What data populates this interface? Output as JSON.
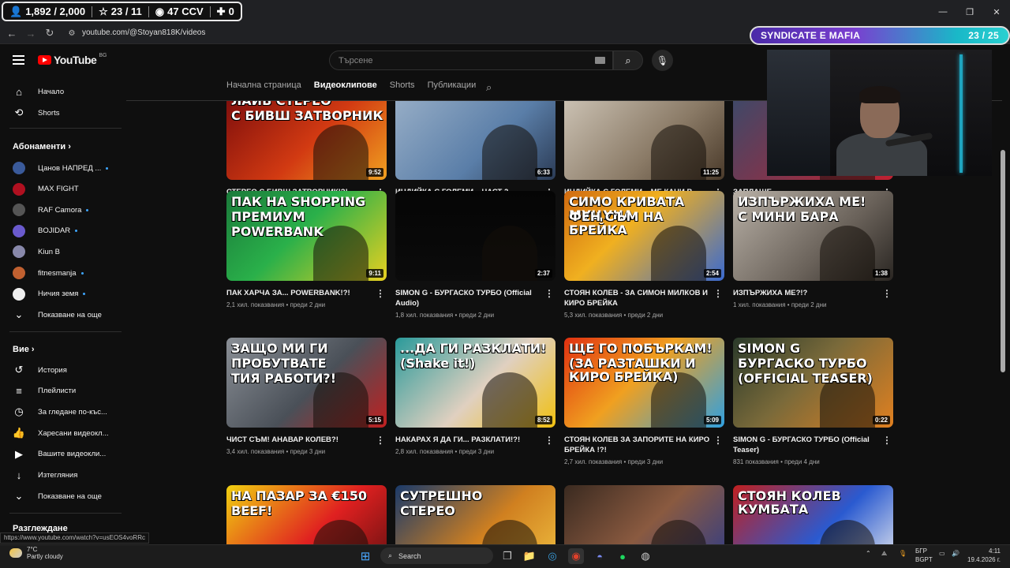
{
  "overlay": {
    "followers": "1,892 / 2,000",
    "stars": "23 / 11",
    "ccv": "47 CCV",
    "plus": "0"
  },
  "browser": {
    "url": "youtube.com/@Stoyan818K/videos",
    "status_url": "https://www.youtube.com/watch?v=usEOS4voRRc"
  },
  "stream_banner": {
    "title": "SYNDICATE E MAFIA",
    "count": "23 / 25"
  },
  "youtube": {
    "logo": "YouTube",
    "country": "BG",
    "search_placeholder": "Търсене"
  },
  "sidebar": {
    "home": "Начало",
    "shorts": "Shorts",
    "subscriptions_heading": "Абонаменти",
    "subscriptions": [
      {
        "name": "Цанов НАПРЕД ...",
        "color": "#3a5a9a",
        "dot": true
      },
      {
        "name": "MAX FIGHT",
        "color": "#b01020",
        "dot": false
      },
      {
        "name": "RAF Camora",
        "color": "#555555",
        "dot": true
      },
      {
        "name": "BOJIDAR",
        "color": "#6a5acd",
        "dot": true
      },
      {
        "name": "Kiun B",
        "color": "#8888aa",
        "dot": false
      },
      {
        "name": "fitnesmanja",
        "color": "#c06030",
        "dot": true
      },
      {
        "name": "Ничия земя",
        "color": "#eeeeee",
        "dot": true
      }
    ],
    "show_more_1": "Показване на още",
    "you_heading": "Вие",
    "you_items": [
      {
        "label": "История",
        "icon": "history-icon",
        "glyph": "↺"
      },
      {
        "label": "Плейлисти",
        "icon": "playlists-icon",
        "glyph": "≡"
      },
      {
        "label": "За гледане по-къс...",
        "icon": "watch-later-icon",
        "glyph": "◷"
      },
      {
        "label": "Харесани видеокл...",
        "icon": "liked-icon",
        "glyph": "👍"
      },
      {
        "label": "Вашите видеокли...",
        "icon": "your-videos-icon",
        "glyph": "▶"
      },
      {
        "label": "Изтегляния",
        "icon": "downloads-icon",
        "glyph": "↓"
      }
    ],
    "show_more_2": "Показване на още",
    "explore_heading": "Разглеждане"
  },
  "tabs": [
    "Начална страница",
    "Видеоклипове",
    "Shorts",
    "Публикации"
  ],
  "videos": [
    {
      "title": "СТЕРЕО С БИВШ ЗАТВОРНИК!?!",
      "meta": "3 хил. показвания • преди 10 часа",
      "duration": "9:52",
      "thumb_text": "ЛАЙВ СТЕРЕО\nС БИВШ ЗАТВОРНИК",
      "bg": "linear-gradient(135deg,#7a0c0c,#d23a12 55%,#f0a020)"
    },
    {
      "title": "ИНДИЙКА С ГОЛЕМИ... ЧАСТ 2",
      "meta": "2,1 хил. показвания • преди 14 часа",
      "duration": "6:33",
      "thumb_text": "",
      "bg": "linear-gradient(135deg,#9ab0c8,#5a7ea8 60%,#2b3b55)"
    },
    {
      "title": "ИНДИЙКА С ГОЛЕМИ... МЕ КАНИ В ДУБАЙ!?!",
      "meta": "9,3 хил. показвания • преди 1 ден",
      "duration": "11:25",
      "thumb_text": "",
      "bg": "linear-gradient(135deg,#cfc6b8,#8a7a66 60%,#4a3a2a)"
    },
    {
      "title": "ЗАПЛАШЕ...",
      "meta": "6,2 хил. показвания",
      "duration": "",
      "thumb_text": "",
      "bg": "linear-gradient(135deg,#3a4a6a,#c02030)"
    },
    {
      "title": "ПАК ХАРЧА ЗА... POWERBANK!?!",
      "meta": "2,1 хил. показвания • преди 2 дни",
      "duration": "9:11",
      "thumb_text": "ПАК НА SHOPPING\nПРЕМИУМ\nPOWERBANK",
      "bg": "linear-gradient(135deg,#1a7a3a,#2ab04a 45%,#e8d020)"
    },
    {
      "title": "SIMON G - БУРГАСКО ТУРБО (Official Audio)",
      "meta": "1,8 хил. показвания • преди 2 дни",
      "duration": "2:37",
      "thumb_text": "",
      "bg": "linear-gradient(180deg,#050505,#0b0b0b)"
    },
    {
      "title": "СТОЯН КОЛЕВ - ЗА СИМОН МИЛКОВ И КИРО БРЕЙКА",
      "meta": "5,3 хил. показвания • преди 2 дни",
      "duration": "2:54",
      "thumb_text": "СИМО КРИВАТА МУЦУНА\nФЕН СЪМ НА БРЕЙКА",
      "bg": "linear-gradient(135deg,#d06a10,#f0b020 40%,#3a6ad0)"
    },
    {
      "title": "ИЗПЪРЖИХА МЕ?!?",
      "meta": "1 хил. показвания • преди 2 дни",
      "duration": "1:38",
      "thumb_text": "ИЗПЪРЖИХА МЕ!\nС МИНИ БАРА",
      "bg": "linear-gradient(135deg,#b8b0a6,#6a625a 60%,#2a2622)"
    },
    {
      "title": "ЧИСТ СЪМ! АНАВАР КОЛЕВ?!",
      "meta": "3,4 хил. показвания • преди 3 дни",
      "duration": "5:15",
      "thumb_text": "ЗАЩО МИ ГИ\nПРОБУТВАТЕ\nТИЯ РАБОТИ?!",
      "bg": "linear-gradient(135deg,#8a8f96,#4a5058 55%,#c02020)"
    },
    {
      "title": "НАКАРАХ Я ДА ГИ... РАЗКЛАТИ!?!",
      "meta": "2,8 хил. показвания • преди 3 дни",
      "duration": "8:52",
      "thumb_text": "...ДА ГИ РАЗКЛАТИ!\n(Shake it!)",
      "bg": "linear-gradient(135deg,#2a9a9a,#e0d0c0 55%,#f0c010)"
    },
    {
      "title": "СТОЯН КОЛЕВ ЗА ЗАПОРИТЕ НА КИРО БРЕЙКА !?!",
      "meta": "2,7 хил. показвания • преди 3 дни",
      "duration": "5:09",
      "thumb_text": "ЩЕ ГО ПОБЪРКАМ!\n(ЗА РАЗТАШКИ И КИРО БРЕЙКА)",
      "bg": "linear-gradient(135deg,#e03010,#f0a020 45%,#30a0e0)"
    },
    {
      "title": "SIMON G - БУРГАСКО ТУРБО (Official Teaser)",
      "meta": "831 показвания • преди 4 дни",
      "duration": "0:22",
      "thumb_text": "SIMON G\nБУРГАСКО ТУРБО\n(OFFICIAL TEASER)",
      "bg": "linear-gradient(135deg,#2a3a2a,#7a6a3a 45%,#e08020)"
    },
    {
      "title": "",
      "meta": "",
      "duration": "",
      "thumb_text": "НА ПАЗАР ЗА €150\nBEEF!",
      "bg": "linear-gradient(135deg,#f0d010,#e02020 55%,#601010)"
    },
    {
      "title": "",
      "meta": "",
      "duration": "",
      "thumb_text": "СУТРЕШНО\nСТЕРЕО",
      "bg": "linear-gradient(135deg,#1a3a6a,#d08020 55%,#f0c040)"
    },
    {
      "title": "",
      "meta": "",
      "duration": "",
      "thumb_text": "",
      "bg": "linear-gradient(135deg,#3a2a20,#8a5a40 50%,#2a3a8a)"
    },
    {
      "title": "",
      "meta": "",
      "duration": "",
      "thumb_text": "СТОЯН КОЛЕВ              КУМБАТА",
      "bg": "linear-gradient(135deg,#c02020,#2a5ad0 55%,#f0f0f0)"
    }
  ],
  "taskbar": {
    "temperature": "7°C",
    "weather": "Partly cloudy",
    "search": "Search",
    "lang1": "БГР",
    "lang2": "BGPT",
    "time": "4:11",
    "date": "19.4.2026 г."
  }
}
